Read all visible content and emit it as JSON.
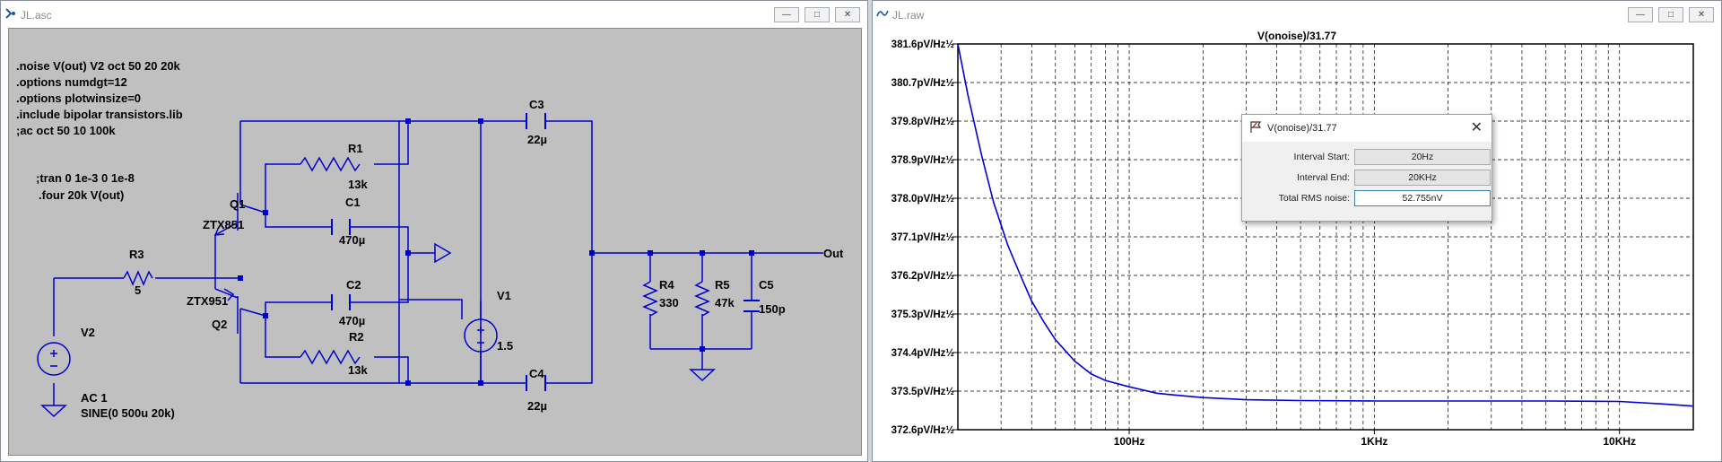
{
  "schematic_window": {
    "title": "JL.asc",
    "directives": [
      ".noise V(out) V2 oct 50 20 20k",
      ".options numdgt=12",
      ".options plotwinsize=0",
      ".include bipolar transistors.lib",
      ";ac oct 50 10 100k"
    ],
    "comments": [
      ";tran 0 1e-3 0 1e-8",
      ".four 20k V(out)"
    ],
    "components": {
      "R1_name": "R1",
      "R1_value": "13k",
      "R2_name": "R2",
      "R2_value": "13k",
      "R3_name": "R3",
      "R3_value": "5",
      "R4_name": "R4",
      "R4_value": "330",
      "R5_name": "R5",
      "R5_value": "47k",
      "C1_name": "C1",
      "C1_value": "470µ",
      "C2_name": "C2",
      "C2_value": "470µ",
      "C3_name": "C3",
      "C3_value": "22µ",
      "C4_name": "C4",
      "C4_value": "22µ",
      "C5_name": "C5",
      "C5_value": "150p",
      "Q1_name": "Q1",
      "Q1_model": "ZTX851",
      "Q2_name": "Q2",
      "Q2_model": "ZTX951",
      "V1_name": "V1",
      "V1_value": "1.5",
      "V2_name": "V2",
      "V2_ac": "AC 1",
      "V2_value": "SINE(0 500u 20k)",
      "out_label": "Out"
    }
  },
  "plot_window": {
    "title": "JL.raw",
    "trace_label": "V(onoise)/31.77",
    "trace_color": "#0000dd"
  },
  "dialog": {
    "title": "V(onoise)/31.77",
    "rows": [
      {
        "label": "Interval Start:",
        "value": "20Hz"
      },
      {
        "label": "Interval End:",
        "value": "20KHz"
      },
      {
        "label": "Total RMS noise:",
        "value": "52.755nV"
      }
    ]
  },
  "chart_data": {
    "type": "line",
    "xscale": "log",
    "xlim": [
      20,
      20000
    ],
    "ylim": [
      372.6,
      381.6
    ],
    "grid": true,
    "x_tick_labels": [
      "100Hz",
      "1KHz",
      "10KHz"
    ],
    "y_tick_labels": [
      "381.6pV/Hz½",
      "380.7pV/Hz½",
      "379.8pV/Hz½",
      "378.9pV/Hz½",
      "378.0pV/Hz½",
      "377.1pV/Hz½",
      "376.2pV/Hz½",
      "375.3pV/Hz½",
      "374.4pV/Hz½",
      "373.5pV/Hz½",
      "372.6pV/Hz½"
    ],
    "series": [
      {
        "name": "V(onoise)/31.77",
        "x": [
          20,
          22,
          25,
          28,
          32,
          36,
          40,
          45,
          50,
          60,
          70,
          80,
          100,
          130,
          160,
          200,
          300,
          500,
          1000,
          2000,
          5000,
          10000,
          15000,
          20000
        ],
        "y": [
          381.6,
          380.4,
          379.0,
          377.9,
          376.9,
          376.2,
          375.6,
          375.1,
          374.7,
          374.2,
          373.9,
          373.75,
          373.6,
          373.45,
          373.4,
          373.35,
          373.3,
          373.28,
          373.27,
          373.27,
          373.27,
          373.26,
          373.2,
          373.15
        ]
      }
    ]
  }
}
